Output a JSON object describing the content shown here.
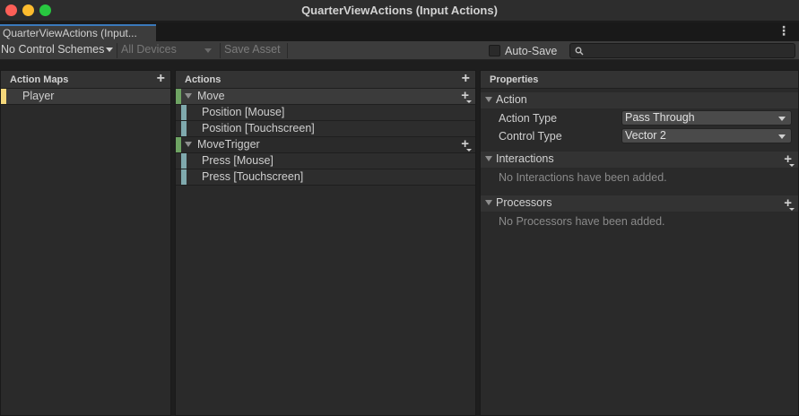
{
  "window": {
    "title": "QuarterViewActions (Input Actions)"
  },
  "tab": {
    "label": "QuarterViewActions (Input..."
  },
  "toolbar": {
    "control_schemes": "No Control Schemes",
    "devices": "All Devices",
    "save_asset": "Save Asset",
    "auto_save": "Auto-Save",
    "search_placeholder": ""
  },
  "action_maps": {
    "header": "Action Maps",
    "items": [
      {
        "label": "Player"
      }
    ]
  },
  "actions": {
    "header": "Actions",
    "items": [
      {
        "label": "Move",
        "bindings": [
          "Position [Mouse]",
          "Position [Touchscreen]"
        ]
      },
      {
        "label": "MoveTrigger",
        "bindings": [
          "Press [Mouse]",
          "Press [Touchscreen]"
        ]
      }
    ]
  },
  "properties": {
    "header": "Properties",
    "action_section": "Action",
    "action_type_label": "Action Type",
    "action_type_value": "Pass Through",
    "control_type_label": "Control Type",
    "control_type_value": "Vector 2",
    "interactions_section": "Interactions",
    "interactions_empty": "No Interactions have been added.",
    "processors_section": "Processors",
    "processors_empty": "No Processors have been added."
  },
  "colors": {
    "map_marker": "#f4d77a",
    "action_marker": "#6ea363",
    "binding_marker": "#7fa9ad",
    "tab_accent": "#3a79bb"
  }
}
